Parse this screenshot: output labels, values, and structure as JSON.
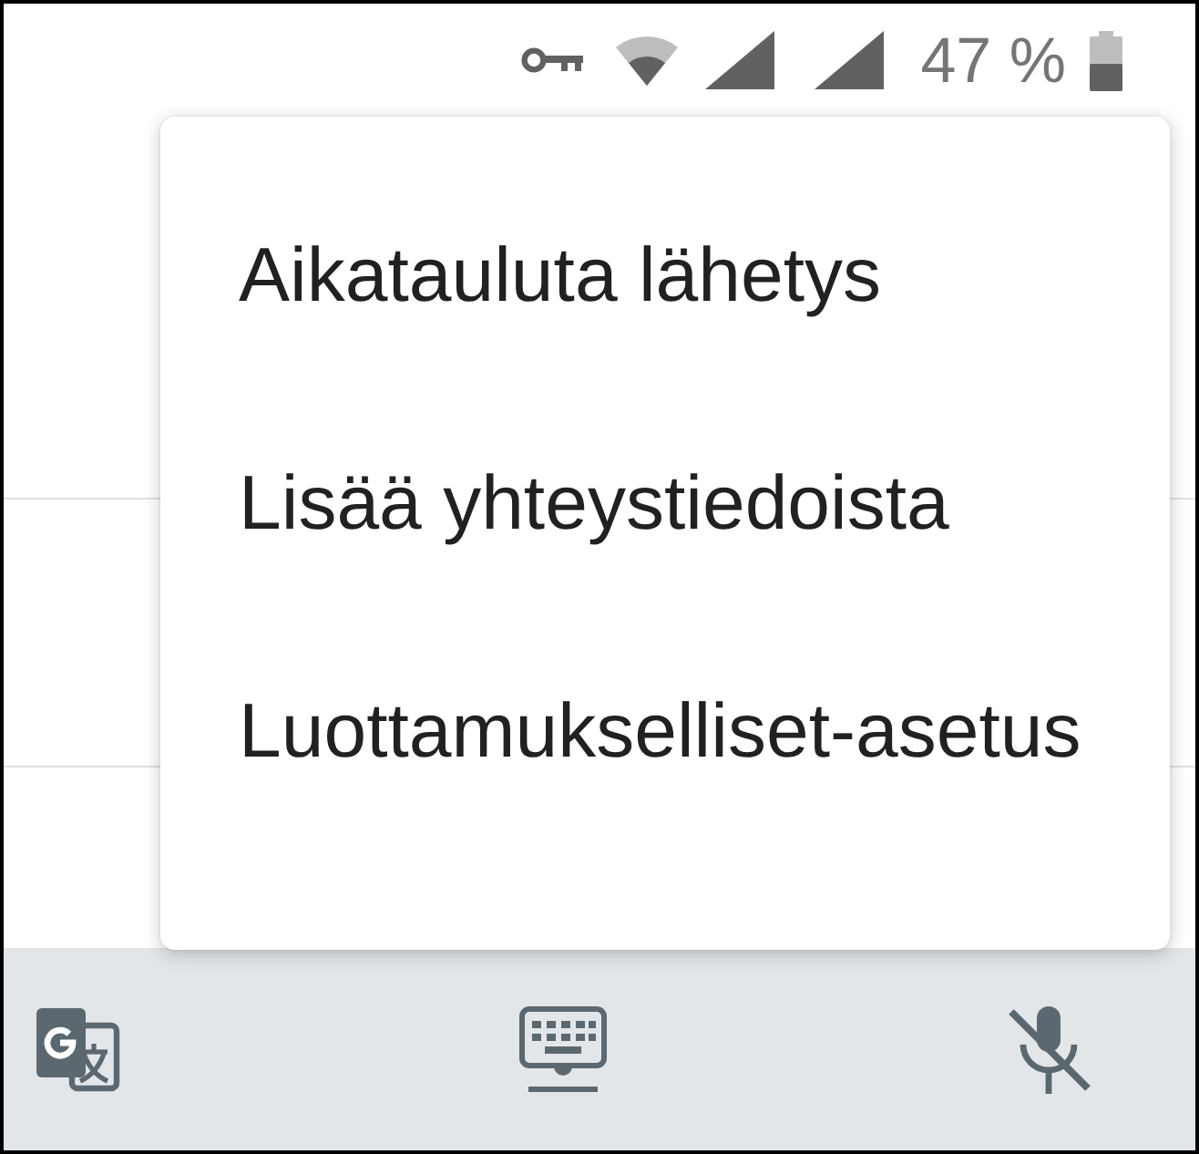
{
  "status_bar": {
    "battery_percent": "47 %"
  },
  "menu": {
    "items": [
      {
        "label": "Aikatauluta lähetys"
      },
      {
        "label": "Lisää yhteystiedoista"
      },
      {
        "label": "Luottamukselliset-asetus"
      }
    ]
  }
}
